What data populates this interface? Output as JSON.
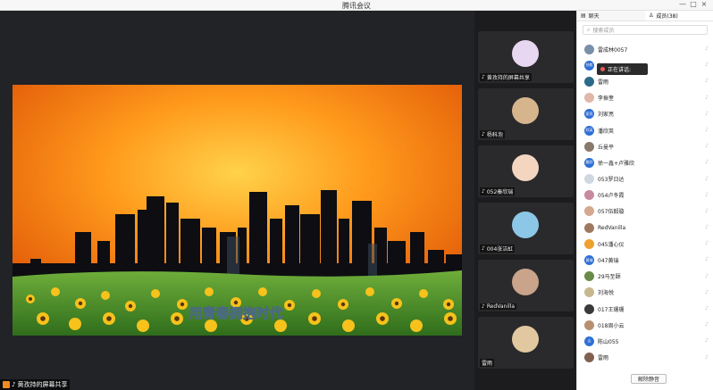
{
  "window": {
    "title": "腾讯会议",
    "controls": [
      "—",
      "□",
      "×"
    ]
  },
  "share": {
    "sharer": "黄孜持的屏幕共享",
    "banner_text": "用青春拥抱时代"
  },
  "tiles": [
    {
      "name": "黄孜持的屏幕共享",
      "color": "#e8d7f0"
    },
    {
      "name": "杨科泡",
      "color": "#d6b48c"
    },
    {
      "name": "052秦欣瑞",
      "color": "#f3d5c0"
    },
    {
      "name": "004张洁虹",
      "color": "#8cc7e8"
    },
    {
      "name": "RedVanilla",
      "color": "#c9a48a"
    },
    {
      "name": "雷雨",
      "color": "#e2c8a0"
    }
  ],
  "panel": {
    "tab_chat": "聊天",
    "tab_members": "成员(38)",
    "search_placeholder": "搜索成员",
    "speaking_label": "正在讲话:",
    "unmute_all": "解除静音",
    "members": [
      {
        "name": "雷成林0057",
        "color": "#7a8fa8",
        "badge": ""
      },
      {
        "name": "扶航",
        "color": "#2f6fd6",
        "badge": "扶航"
      },
      {
        "name": "雷雨",
        "color": "#2a6a8a",
        "badge": ""
      },
      {
        "name": "李振奎",
        "color": "#e0b7a8",
        "badge": ""
      },
      {
        "name": "刘家亮",
        "color": "#2f6fd6",
        "badge": "家亮"
      },
      {
        "name": "潘欣英",
        "color": "#2f6fd6",
        "badge": "欣英"
      },
      {
        "name": "丘曼平",
        "color": "#8a7a6a",
        "badge": ""
      },
      {
        "name": "徐一鑫+卢雅欣",
        "color": "#2f6fd6",
        "badge": "雅欣"
      },
      {
        "name": "053罗日达",
        "color": "#cfd8e0",
        "badge": ""
      },
      {
        "name": "054卢冬霞",
        "color": "#c78aa0",
        "badge": ""
      },
      {
        "name": "057伍毅璇",
        "color": "#d6a890",
        "badge": ""
      },
      {
        "name": "RedVanilla",
        "color": "#a07860",
        "badge": ""
      },
      {
        "name": "045潘心仪",
        "color": "#f0a030",
        "badge": ""
      },
      {
        "name": "047黄瑞",
        "color": "#2f6fd6",
        "badge": "黄瑞"
      },
      {
        "name": "29马至颐",
        "color": "#6a8a4a",
        "badge": ""
      },
      {
        "name": "刘海悦",
        "color": "#c8b890",
        "badge": ""
      },
      {
        "name": "017王珊珊",
        "color": "#3a3a3a",
        "badge": ""
      },
      {
        "name": "018周小云",
        "color": "#b89070",
        "badge": ""
      },
      {
        "name": "陈山055",
        "color": "#2f6fd6",
        "badge": "山"
      },
      {
        "name": "雷雨",
        "color": "#806050",
        "badge": ""
      }
    ]
  }
}
